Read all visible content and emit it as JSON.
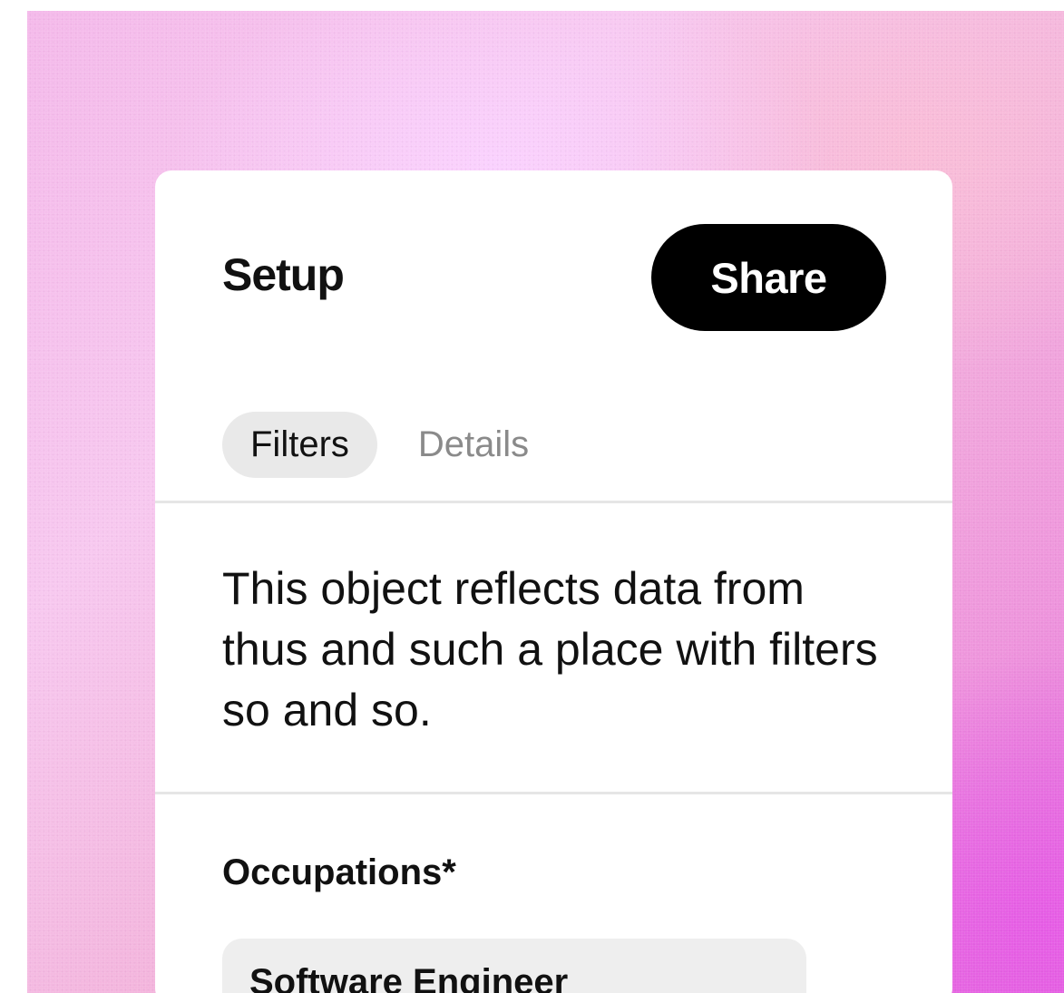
{
  "card": {
    "title": "Setup",
    "share_label": "Share"
  },
  "tabs": [
    {
      "label": "Filters",
      "active": true
    },
    {
      "label": "Details",
      "active": false
    }
  ],
  "description": "This object reflects data from thus and such a place with filters so and so.",
  "occupations": {
    "label": "Occupations*",
    "selected": [
      "Software Engineer"
    ]
  },
  "colors": {
    "background_light": "#f7c8ef",
    "background_deep": "#e06ad9",
    "button": "#000000",
    "active_tab": "#e9e9e9",
    "inactive_tab_text": "#8a8a8a",
    "chip": "#eeeeee"
  }
}
